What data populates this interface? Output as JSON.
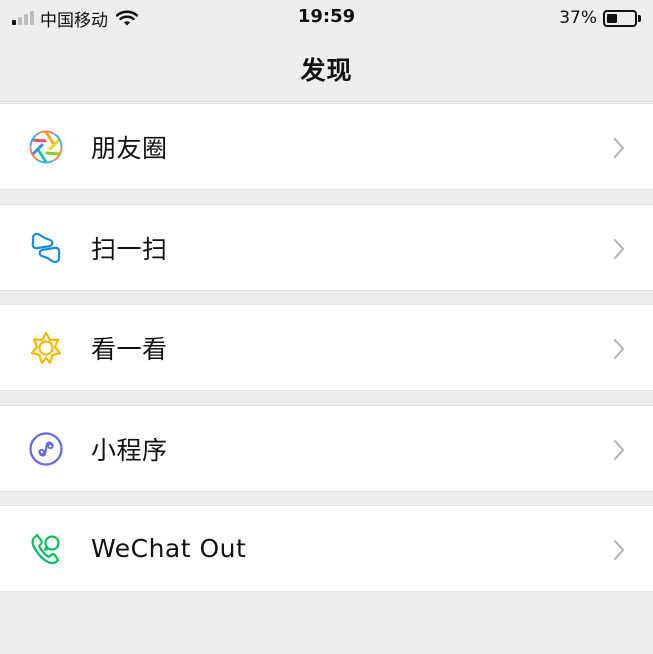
{
  "status_bar": {
    "carrier": "中国移动",
    "time": "19:59",
    "battery_percent": "37%",
    "battery_level": 0.37,
    "signal_bars_active": 1,
    "signal_bars_total": 4
  },
  "nav": {
    "title": "发现"
  },
  "menu": {
    "items": [
      {
        "label": "朋友圈",
        "icon": "moments-icon"
      },
      {
        "label": "扫一扫",
        "icon": "scan-icon"
      },
      {
        "label": "看一看",
        "icon": "top-stories-icon"
      },
      {
        "label": "小程序",
        "icon": "mini-programs-icon"
      },
      {
        "label": "WeChat Out",
        "icon": "phone-icon"
      }
    ]
  },
  "colors": {
    "background": "#ededed",
    "row": "#ffffff",
    "scan_blue": "#1a8ce8",
    "star_yellow": "#f5b800",
    "mini_purple": "#6467f0",
    "phone_green": "#07c160",
    "chevron": "#b2b2b2"
  }
}
